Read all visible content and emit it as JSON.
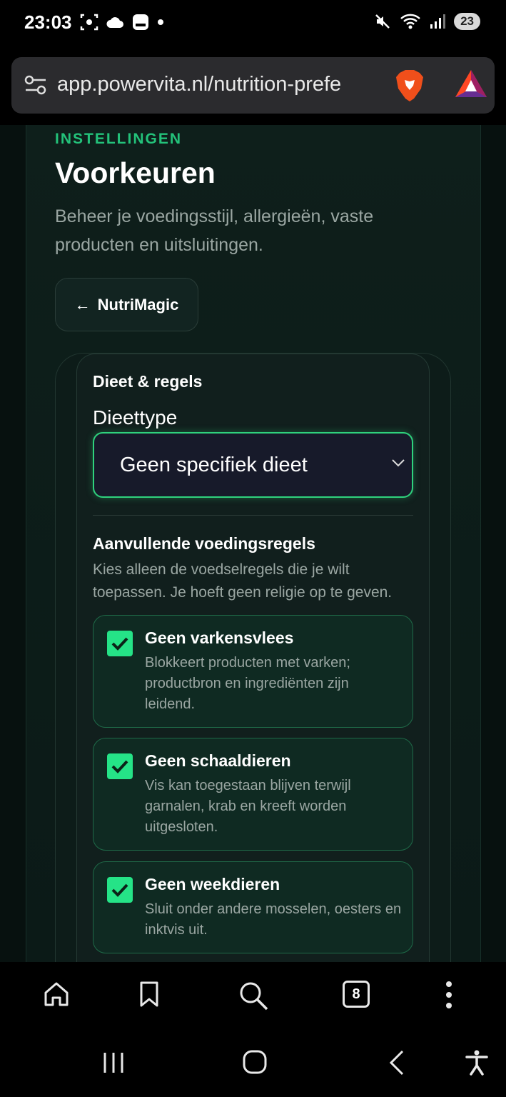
{
  "status": {
    "time": "23:03",
    "battery": "23"
  },
  "browser": {
    "url": "app.powervita.nl/nutrition-prefe",
    "tabs_count": "8"
  },
  "page": {
    "kicker": "INSTELLINGEN",
    "title": "Voorkeuren",
    "subtitle": "Beheer je voedingsstijl, allergieën, vaste producten en uitsluitingen.",
    "back_label": "NutriMagic",
    "back_arrow": "←",
    "section_title": "Dieet & regels",
    "diet_label": "Dieettype",
    "diet_value": "Geen specifiek dieet",
    "rules_title": "Aanvullende voedingsregels",
    "rules_desc": "Kies alleen de voedselregels die je wilt toepassen. Je hoeft geen religie op te geven.",
    "rules": [
      {
        "title": "Geen varkensvlees",
        "desc": "Blokkeert producten met varken; productbron en ingrediënten zijn leidend.",
        "checked": true
      },
      {
        "title": "Geen schaaldieren",
        "desc": "Vis kan toegestaan blijven terwijl garnalen, krab en kreeft worden uitgesloten.",
        "checked": true
      },
      {
        "title": "Geen weekdieren",
        "desc": "Sluit onder andere mosselen, oesters en inktvis uit.",
        "checked": true
      }
    ]
  },
  "colors": {
    "accent": "#25e387",
    "kicker": "#23c27a",
    "background": "#07110f"
  }
}
